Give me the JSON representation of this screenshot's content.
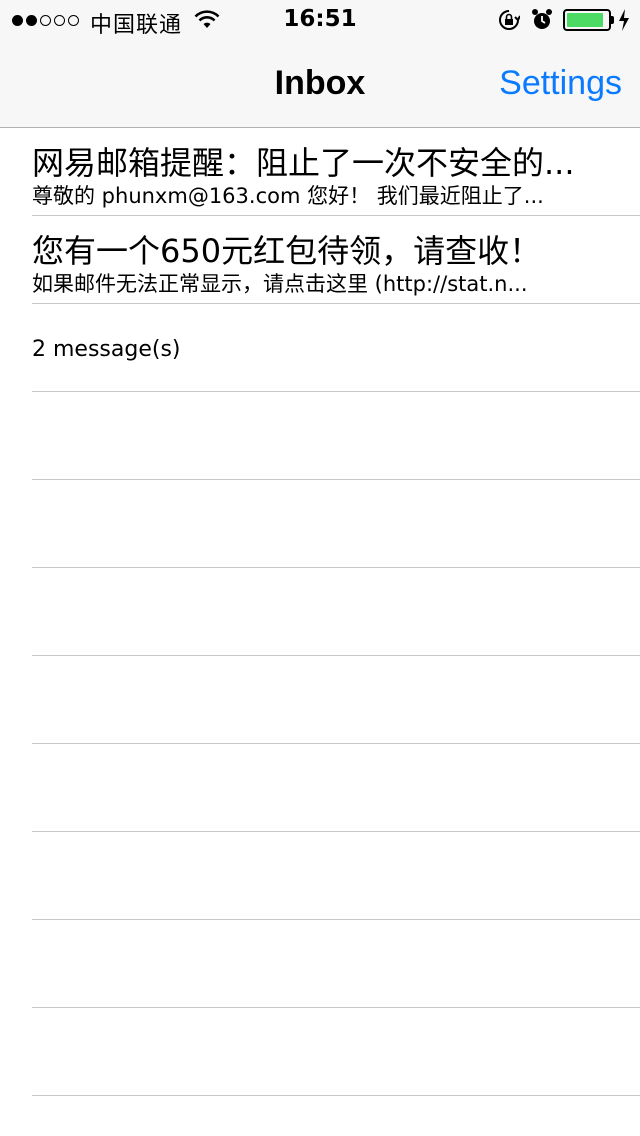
{
  "status_bar": {
    "signal_filled": 2,
    "signal_total": 5,
    "carrier": "中国联通",
    "time": "16:51",
    "battery_level": 0.9,
    "battery_color": "#4cd964"
  },
  "nav": {
    "title": "Inbox",
    "settings_label": "Settings",
    "accent_color": "#0a7aff"
  },
  "messages": [
    {
      "subject": "网易邮箱提醒：阻止了一次不安全的...",
      "preview": "尊敬的 phunxm@163.com 您好！  我们最近阻止了..."
    },
    {
      "subject": "您有一个650元红包待领，请查收！",
      "preview": "如果邮件无法正常显示，请点击这里 (http://stat.n..."
    }
  ],
  "message_count_label": "2 message(s)",
  "icons": [
    "wifi-icon",
    "rotation-lock-icon",
    "alarm-icon",
    "battery-icon",
    "charging-icon"
  ]
}
